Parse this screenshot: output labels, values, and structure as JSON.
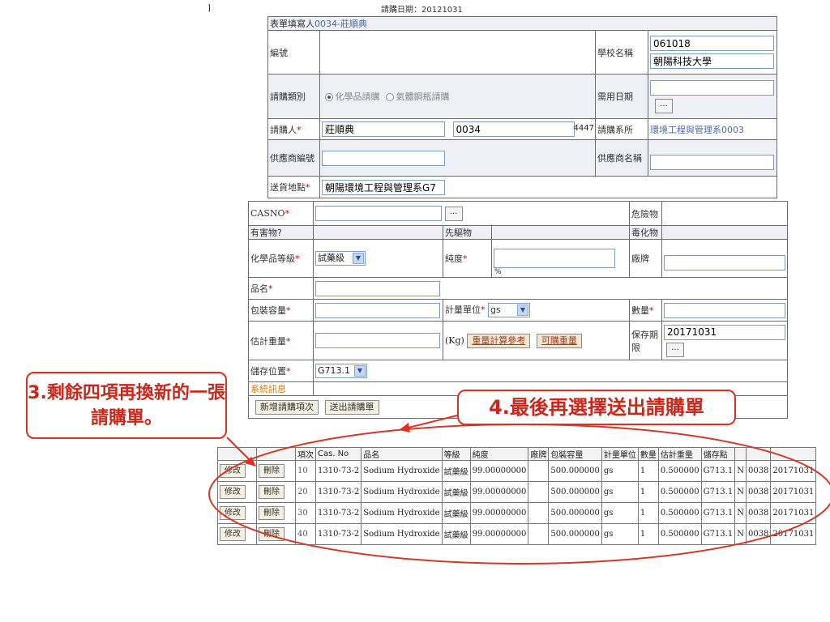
{
  "page": {
    "corner_mark": "]",
    "date_label": "請購日期：",
    "date_value": "20121031"
  },
  "header_form": {
    "filler_label": "表單填寫人",
    "filler_value": "0034-莊順典",
    "number_label": "編號",
    "school_label": "學校名稱",
    "school_code": "061018",
    "school_name": "朝陽科技大學",
    "type_label": "請購類別",
    "type_options": [
      "化學品請購",
      "氣體鋼瓶請購"
    ],
    "needed_date_label": "需用日期",
    "requester_label": "請購人",
    "requester_name": "莊順典",
    "requester_code": "0034",
    "ext": "4447",
    "dept_label": "請購系所",
    "dept_value": "環境工程與管理系0003",
    "supplier_no_label": "供應商編號",
    "supplier_name_label": "供應商名稱",
    "delivery_label": "送貨地點",
    "delivery_value": "朝陽環境工程與管理系G7"
  },
  "item_form": {
    "casno_label": "CASNO",
    "hazard_label": "危險物",
    "harmful_label": "有害物?",
    "precursor_label": "先驅物",
    "toxic_label": "毒化物",
    "grade_label": "化學品等級",
    "grade_value": "試藥級",
    "purity_label": "純度",
    "percent": "%",
    "brand_label": "廠牌",
    "product_label": "品名",
    "pack_label": "包裝容量",
    "unit_label": "計量單位",
    "unit_value": "gs",
    "qty_label": "數量",
    "weight_label": "估計重量",
    "kg": "(Kg)",
    "weight_ref_btn": "重量計算參考",
    "buyable_weight_btn": "可購重量",
    "shelf_label": "保存期限",
    "shelf_value": "20171031",
    "storage_label": "儲存位置",
    "storage_value": "G713.1",
    "sysmsg_label": "系統訊息",
    "add_item_btn": "新增請購項次",
    "submit_btn": "送出請購單"
  },
  "callouts": {
    "left": "3.剩餘四項再換新的一張請購單。",
    "right": "4.最後再選擇送出請購單"
  },
  "item_list": {
    "headers": [
      "項次",
      "Cas. No",
      "品名",
      "等級",
      "純度",
      "廠牌",
      "包裝容量",
      "計量單位",
      "數量",
      "估計重量",
      "儲存點",
      "",
      "",
      ""
    ],
    "edit_label": "修改",
    "delete_label": "刪除",
    "rows": [
      [
        "10",
        "1310-73-2",
        "Sodium Hydroxide",
        "試藥級",
        "99.00000000",
        "",
        "500.000000",
        "gs",
        "1",
        "0.500000",
        "G713.1",
        "N",
        "0038",
        "20171031"
      ],
      [
        "20",
        "1310-73-2",
        "Sodium Hydroxide",
        "試藥級",
        "99.00000000",
        "",
        "500.000000",
        "gs",
        "1",
        "0.500000",
        "G713.1",
        "N",
        "0038",
        "20171031"
      ],
      [
        "30",
        "1310-73-2",
        "Sodium Hydroxide",
        "試藥級",
        "99.00000000",
        "",
        "500.000000",
        "gs",
        "1",
        "0.500000",
        "G713.1",
        "N",
        "0038",
        "20171031"
      ],
      [
        "40",
        "1310-73-2",
        "Sodium Hydroxide",
        "試藥級",
        "99.00000000",
        "",
        "500.000000",
        "gs",
        "1",
        "0.500000",
        "G713.1",
        "N",
        "0038",
        "20171031"
      ]
    ]
  },
  "colors": {
    "callout": "#e03020",
    "required": "#d00000",
    "accent_border": "#7f9db9"
  }
}
